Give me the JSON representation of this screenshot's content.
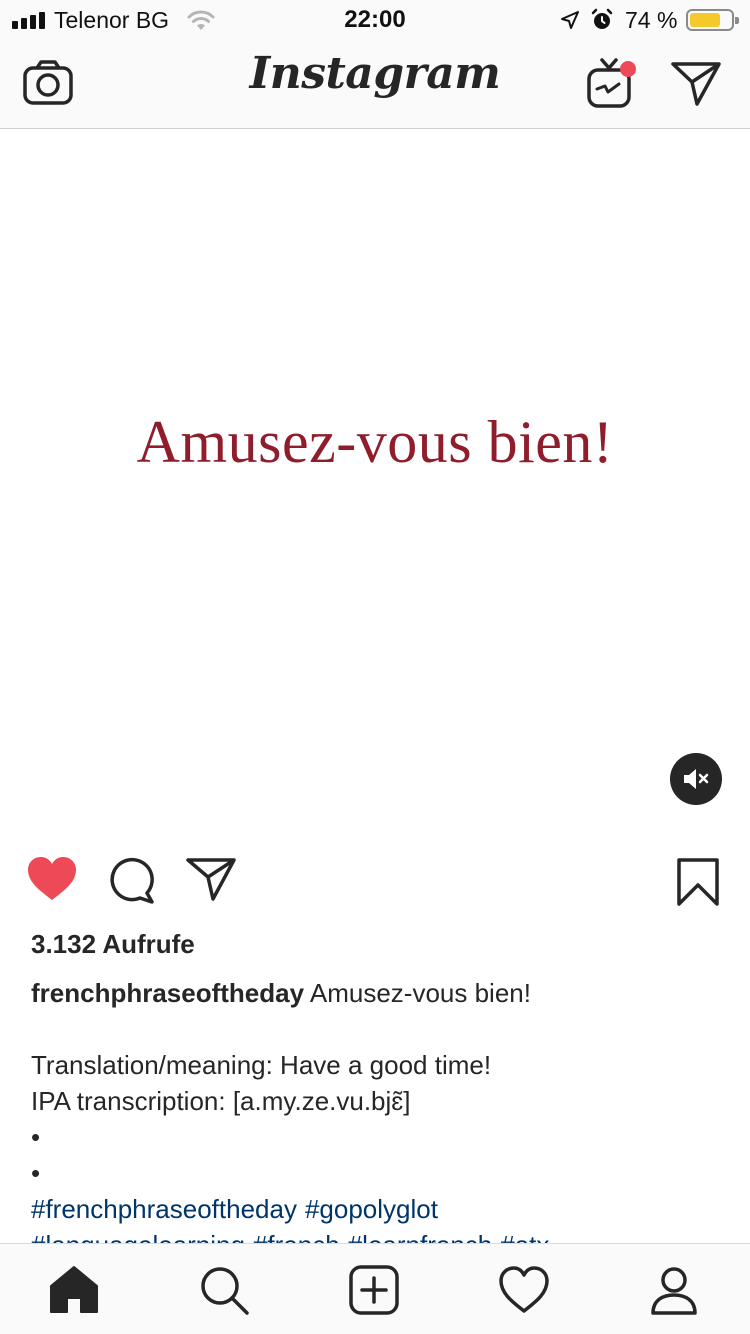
{
  "status_bar": {
    "carrier": "Telenor BG",
    "time": "22:00",
    "battery_percent": "74 %",
    "battery_level": 0.74,
    "signal_bars": 4
  },
  "nav": {
    "logo": "Instagram",
    "igtv_notification_color": "#ed4956"
  },
  "post": {
    "media_text": "Amusez-vous bien!",
    "media_text_color": "#8f1d2c",
    "liked": true,
    "like_color": "#ed4956",
    "views": "3.132 Aufrufe",
    "username": "frenchphraseoftheday",
    "caption_title": " Amusez-vous bien!",
    "caption_lines": [
      "Translation/meaning: Have a good time!",
      "IPA transcription: [a.my.ze.vu.bjɛ̃]",
      "•",
      "•"
    ],
    "hashtags_line1": [
      "#frenchphraseoftheday",
      "#gopolyglot"
    ],
    "hashtags_line2": [
      "#languagelearning",
      "#french",
      "#learnfrench",
      "#atx"
    ],
    "hashtag_color": "#003569"
  },
  "tab_bar": {
    "items": [
      "home-icon",
      "search-icon",
      "add-post-icon",
      "activity-heart-icon",
      "profile-icon"
    ],
    "active": "home"
  }
}
